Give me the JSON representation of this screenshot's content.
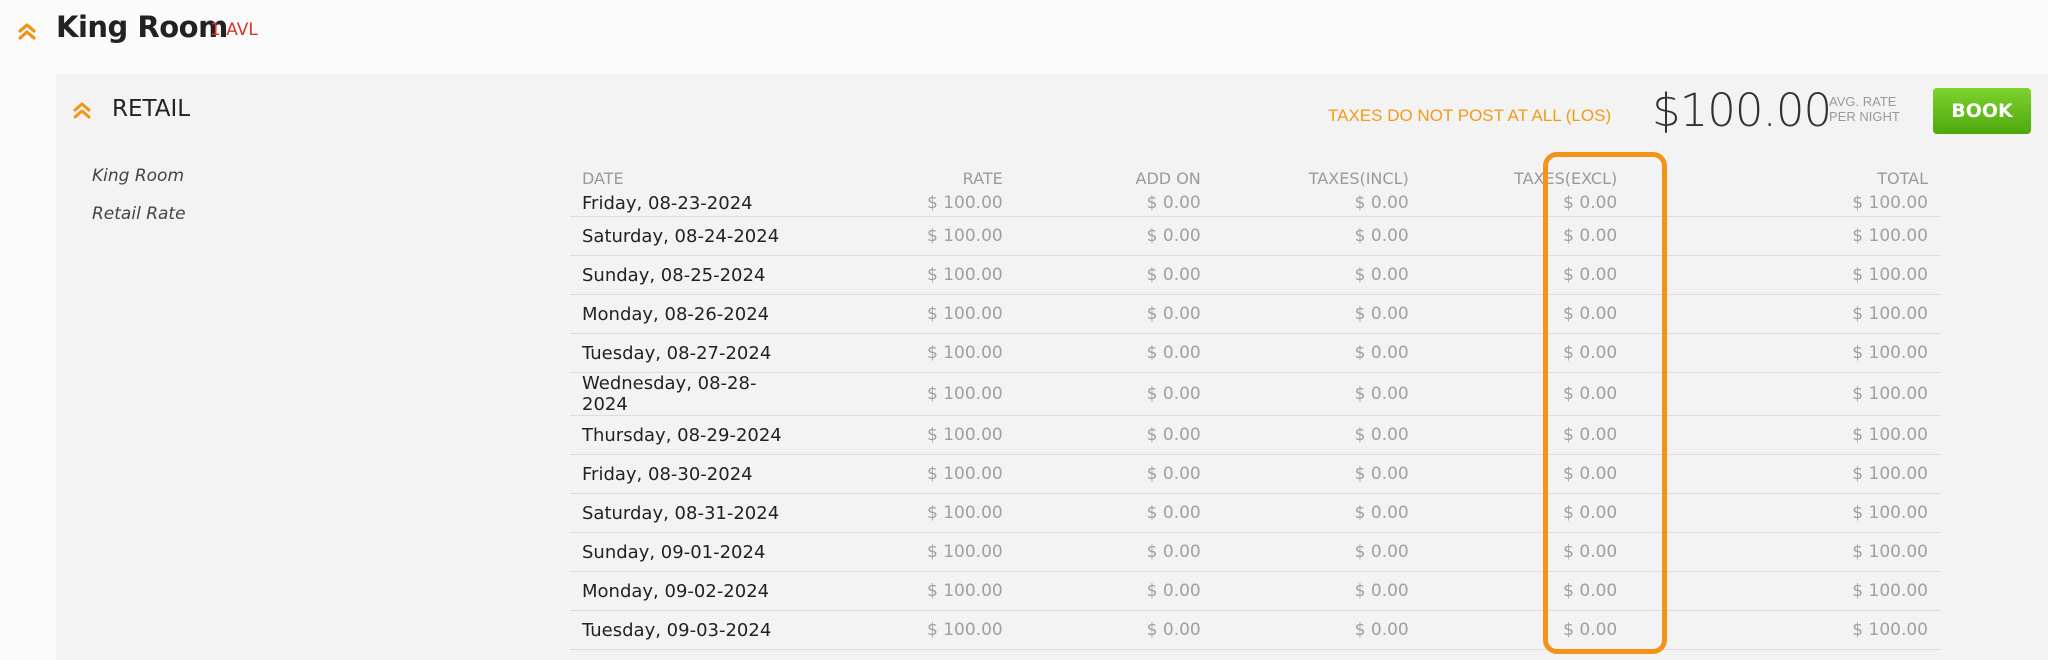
{
  "room": {
    "title": "King Room",
    "availability": "1 AVL"
  },
  "rate_plan": {
    "title": "RETAIL",
    "tax_note": "TAXES DO NOT POST AT ALL (LOS)",
    "avg_rate": "$100.00",
    "avg_label_line1": "AVG. RATE",
    "avg_label_line2": "PER NIGHT",
    "book_label": "BOOK",
    "room_name": "King Room",
    "rate_name": "Retail Rate"
  },
  "table": {
    "headers": {
      "date": "DATE",
      "rate": "RATE",
      "add_on": "ADD ON",
      "taxes_incl": "TAXES(INCL)",
      "taxes_excl": "TAXES(EXCL)",
      "total": "TOTAL"
    },
    "rows": [
      {
        "date": "Friday, 08-23-2024",
        "rate": "$ 100.00",
        "add_on": "$ 0.00",
        "taxes_incl": "$ 0.00",
        "taxes_excl": "$ 0.00",
        "total": "$ 100.00"
      },
      {
        "date": "Saturday, 08-24-2024",
        "rate": "$ 100.00",
        "add_on": "$ 0.00",
        "taxes_incl": "$ 0.00",
        "taxes_excl": "$ 0.00",
        "total": "$ 100.00"
      },
      {
        "date": "Sunday, 08-25-2024",
        "rate": "$ 100.00",
        "add_on": "$ 0.00",
        "taxes_incl": "$ 0.00",
        "taxes_excl": "$ 0.00",
        "total": "$ 100.00"
      },
      {
        "date": "Monday, 08-26-2024",
        "rate": "$ 100.00",
        "add_on": "$ 0.00",
        "taxes_incl": "$ 0.00",
        "taxes_excl": "$ 0.00",
        "total": "$ 100.00"
      },
      {
        "date": "Tuesday, 08-27-2024",
        "rate": "$ 100.00",
        "add_on": "$ 0.00",
        "taxes_incl": "$ 0.00",
        "taxes_excl": "$ 0.00",
        "total": "$ 100.00"
      },
      {
        "date": "Wednesday, 08-28-2024",
        "rate": "$ 100.00",
        "add_on": "$ 0.00",
        "taxes_incl": "$ 0.00",
        "taxes_excl": "$ 0.00",
        "total": "$ 100.00"
      },
      {
        "date": "Thursday, 08-29-2024",
        "rate": "$ 100.00",
        "add_on": "$ 0.00",
        "taxes_incl": "$ 0.00",
        "taxes_excl": "$ 0.00",
        "total": "$ 100.00"
      },
      {
        "date": "Friday, 08-30-2024",
        "rate": "$ 100.00",
        "add_on": "$ 0.00",
        "taxes_incl": "$ 0.00",
        "taxes_excl": "$ 0.00",
        "total": "$ 100.00"
      },
      {
        "date": "Saturday, 08-31-2024",
        "rate": "$ 100.00",
        "add_on": "$ 0.00",
        "taxes_incl": "$ 0.00",
        "taxes_excl": "$ 0.00",
        "total": "$ 100.00"
      },
      {
        "date": "Sunday, 09-01-2024",
        "rate": "$ 100.00",
        "add_on": "$ 0.00",
        "taxes_incl": "$ 0.00",
        "taxes_excl": "$ 0.00",
        "total": "$ 100.00"
      },
      {
        "date": "Monday, 09-02-2024",
        "rate": "$ 100.00",
        "add_on": "$ 0.00",
        "taxes_incl": "$ 0.00",
        "taxes_excl": "$ 0.00",
        "total": "$ 100.00"
      },
      {
        "date": "Tuesday, 09-03-2024",
        "rate": "$ 100.00",
        "add_on": "$ 0.00",
        "taxes_incl": "$ 0.00",
        "taxes_excl": "$ 0.00",
        "total": "$ 100.00"
      }
    ]
  },
  "icons": {
    "collapse": "double-chevron-up-icon"
  },
  "colors": {
    "accent": "#f39318",
    "avl": "#d9342b",
    "book": "#5cb515"
  }
}
